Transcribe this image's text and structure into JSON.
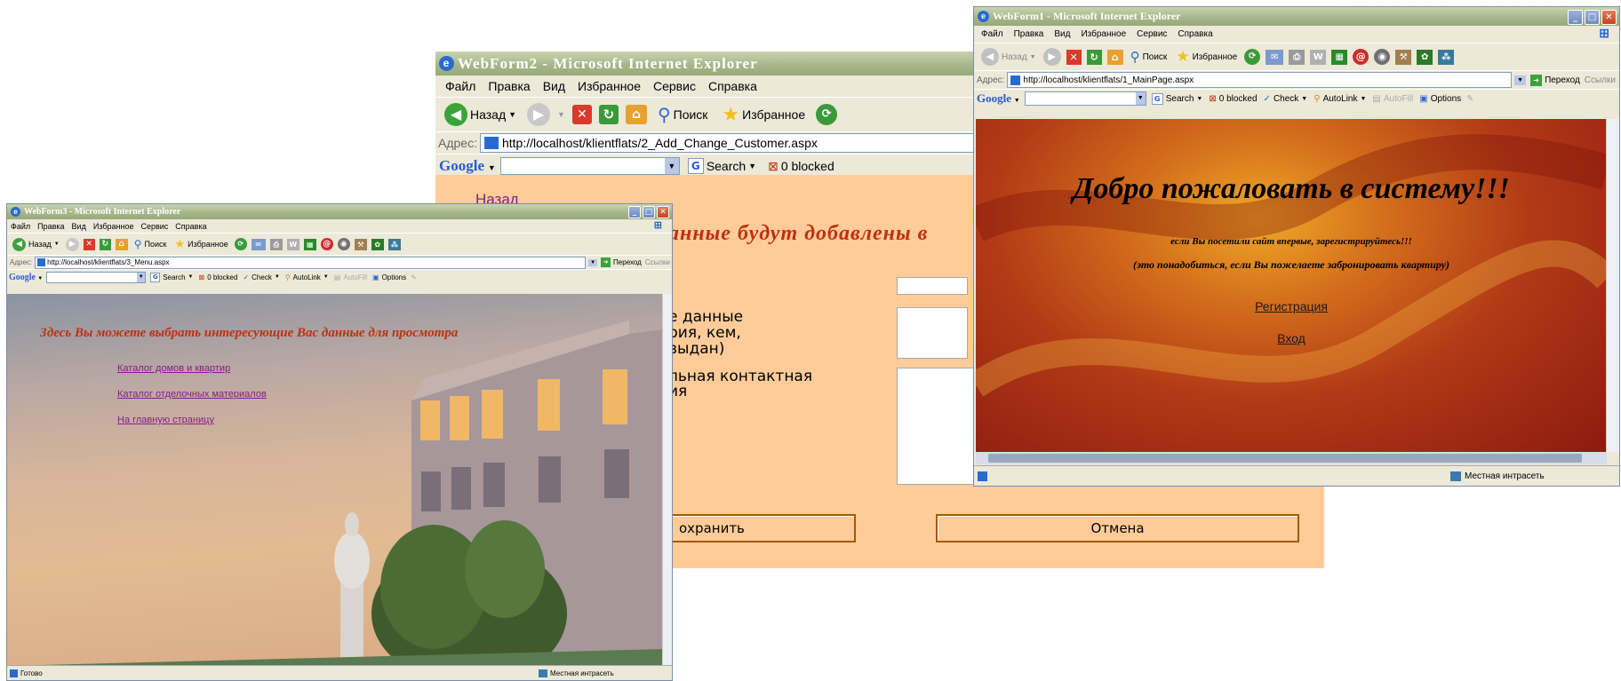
{
  "colors": {
    "menu_bg": "#ffcc99",
    "form_bg": "#ffcc99",
    "main_bg_dark": "#8c1a10",
    "main_bg_light": "#e5961e",
    "link_purple": "#8a1a8a",
    "heading_red": "#c03010"
  },
  "ie": {
    "menu": [
      "Файл",
      "Правка",
      "Вид",
      "Избранное",
      "Сервис",
      "Справка"
    ],
    "back": "Назад",
    "search": "Поиск",
    "favorites": "Избранное",
    "address_label": "Адрес:",
    "go": "Переход",
    "links": "Ссылки",
    "google": "Google",
    "g_search": "Search",
    "blocked": "0 blocked",
    "check": "Check",
    "autolink": "AutoLink",
    "autofill": "AutoFill",
    "options": "Options",
    "intranet": "Местная интрасеть",
    "done": "Готово"
  },
  "windows": {
    "menu": {
      "title": "WebForm3 - Microsoft Internet Explorer",
      "url": "http://localhost/klientflats/3_Menu.aspx",
      "heading": "Здесь Вы можете выбрать интересующие Вас данные для просмотра",
      "links": [
        "Каталог домов и квартир",
        "Каталог отделочных материалов",
        "На главную страницу"
      ]
    },
    "customer": {
      "title": "WebForm2 - Microsoft Internet Explorer",
      "url": "http://localhost/klientflats/2_Add_Change_Customer.aspx",
      "back_link": "Назад",
      "heading": "анные будут добавлены в",
      "passport_label": "е данные\nрия, кем,\nвыдан)",
      "contact_label": "льная контактная\nия",
      "save": "охранить",
      "cancel": "Отмена"
    },
    "main": {
      "title": "WebForm1 - Microsoft Internet Explorer",
      "url": "http://localhost/klientflats/1_MainPage.aspx",
      "welcome": "Добро пожаловать в систему!!!",
      "line1": "если Вы посетили сайт впервые, зарегистрируйтесь!!!",
      "line2": "(это понадобиться, если Вы пожелаете забронировать квартиру)",
      "register": "Регистрация",
      "login": "Вход"
    }
  }
}
